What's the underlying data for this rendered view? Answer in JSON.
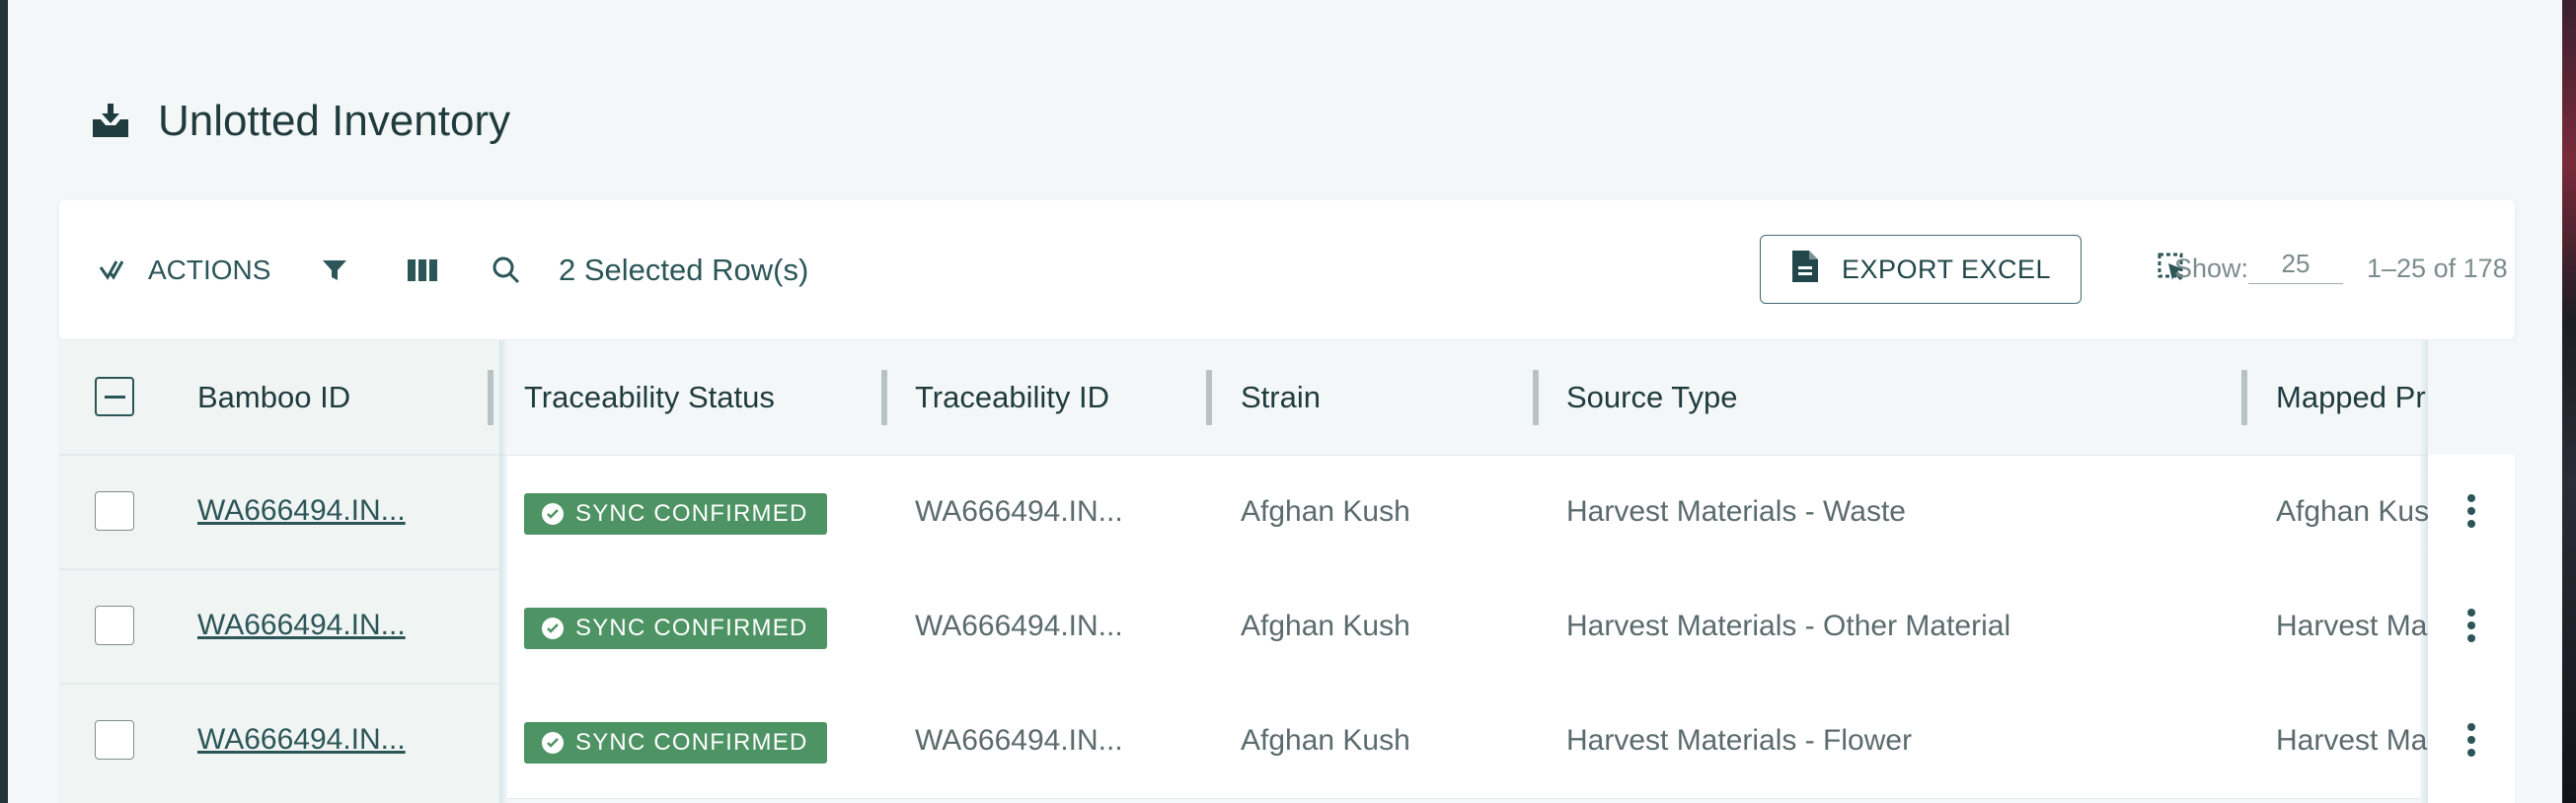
{
  "page": {
    "title": "Unlotted Inventory",
    "icon": "inbox-download-icon"
  },
  "toolbar": {
    "actions_label": "ACTIONS",
    "actions_icon": "double-check-icon",
    "filter_icon": "filter-icon",
    "columns_icon": "columns-icon",
    "search_icon": "search-icon",
    "selected_text": "2 Selected Row(s)",
    "export_label": "EXPORT EXCEL",
    "export_icon": "document-icon",
    "select_cursor_icon": "cursor-select-icon",
    "show_label": "Show:",
    "page_size": "25",
    "range_text": "1–25 of 178"
  },
  "table": {
    "columns": [
      "Bamboo ID",
      "Traceability Status",
      "Traceability ID",
      "Strain",
      "Source Type",
      "Mapped Pr"
    ],
    "rows": [
      {
        "bamboo_id": "WA666494.IN...",
        "status": "SYNC CONFIRMED",
        "traceability_id": "WA666494.IN...",
        "strain": "Afghan Kush",
        "source_type": "Harvest Materials - Waste",
        "mapped": "Afghan Kush"
      },
      {
        "bamboo_id": "WA666494.IN...",
        "status": "SYNC CONFIRMED",
        "traceability_id": "WA666494.IN...",
        "strain": "Afghan Kush",
        "source_type": "Harvest Materials - Other Material",
        "mapped": "Harvest Ma"
      },
      {
        "bamboo_id": "WA666494.IN...",
        "status": "SYNC CONFIRMED",
        "traceability_id": "WA666494.IN...",
        "strain": "Afghan Kush",
        "source_type": "Harvest Materials - Flower",
        "mapped": "Harvest Ma"
      }
    ]
  },
  "colors": {
    "accent": "#2c5558",
    "badge": "#4d9364",
    "background": "#f4f7f8"
  }
}
